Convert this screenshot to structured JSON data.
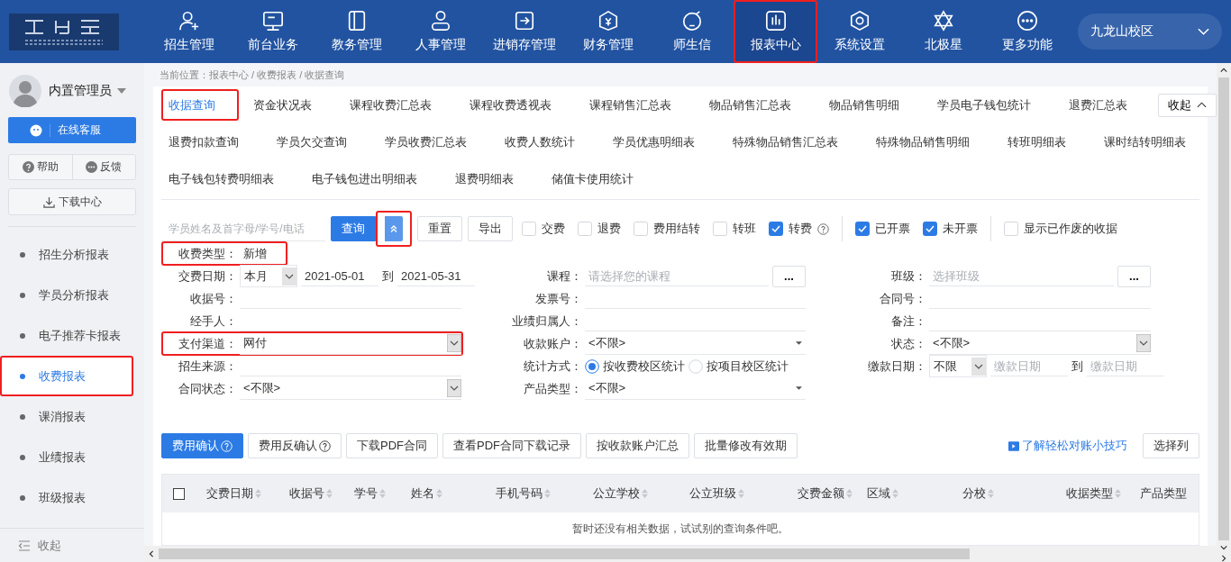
{
  "header": {
    "nav": [
      {
        "label": "招生管理",
        "selected": false,
        "highlighted": false
      },
      {
        "label": "前台业务",
        "selected": false,
        "highlighted": false
      },
      {
        "label": "教务管理",
        "selected": false,
        "highlighted": false
      },
      {
        "label": "人事管理",
        "selected": false,
        "highlighted": false
      },
      {
        "label": "进销存管理",
        "selected": false,
        "highlighted": false
      },
      {
        "label": "财务管理",
        "selected": false,
        "highlighted": false
      },
      {
        "label": "师生信",
        "selected": false,
        "highlighted": false
      },
      {
        "label": "报表中心",
        "selected": true,
        "highlighted": true
      },
      {
        "label": "系统设置",
        "selected": false,
        "highlighted": false
      },
      {
        "label": "北极星",
        "selected": false,
        "highlighted": false
      },
      {
        "label": "更多功能",
        "selected": false,
        "highlighted": false
      }
    ],
    "campus": "九龙山校区"
  },
  "sidebar": {
    "user": "内置管理员",
    "service_button": "在线客服",
    "help_button": "帮助",
    "feedback_button": "反馈",
    "download_button": "下载中心",
    "items": [
      {
        "label": "招生分析报表",
        "selected": false,
        "highlighted": false
      },
      {
        "label": "学员分析报表",
        "selected": false,
        "highlighted": false
      },
      {
        "label": "电子推荐卡报表",
        "selected": false,
        "highlighted": false
      },
      {
        "label": "收费报表",
        "selected": true,
        "highlighted": true
      },
      {
        "label": "课消报表",
        "selected": false,
        "highlighted": false
      },
      {
        "label": "业绩报表",
        "selected": false,
        "highlighted": false
      },
      {
        "label": "班级报表",
        "selected": false,
        "highlighted": false
      }
    ],
    "collapse": "收起"
  },
  "breadcrumb": "当前位置：报表中心 / 收费报表 / 收据查询",
  "report_tabs": [
    [
      {
        "label": "收据查询",
        "selected": true,
        "highlighted": true
      },
      {
        "label": "资金状况表",
        "selected": false,
        "highlighted": false
      },
      {
        "label": "课程收费汇总表",
        "selected": false,
        "highlighted": false
      },
      {
        "label": "课程收费透视表",
        "selected": false,
        "highlighted": false
      },
      {
        "label": "课程销售汇总表",
        "selected": false,
        "highlighted": false
      },
      {
        "label": "物品销售汇总表",
        "selected": false,
        "highlighted": false
      },
      {
        "label": "物品销售明细",
        "selected": false,
        "highlighted": false
      },
      {
        "label": "学员电子钱包统计",
        "selected": false,
        "highlighted": false
      },
      {
        "label": "退费汇总表",
        "selected": false,
        "highlighted": false
      }
    ],
    [
      {
        "label": "退费扣款查询",
        "selected": false,
        "highlighted": false
      },
      {
        "label": "学员欠交查询",
        "selected": false,
        "highlighted": false
      },
      {
        "label": "学员收费汇总表",
        "selected": false,
        "highlighted": false
      },
      {
        "label": "收费人数统计",
        "selected": false,
        "highlighted": false
      },
      {
        "label": "学员优惠明细表",
        "selected": false,
        "highlighted": false
      },
      {
        "label": "特殊物品销售汇总表",
        "selected": false,
        "highlighted": false
      },
      {
        "label": "特殊物品销售明细",
        "selected": false,
        "highlighted": false
      },
      {
        "label": "转班明细表",
        "selected": false,
        "highlighted": false
      },
      {
        "label": "课时结转明细表",
        "selected": false,
        "highlighted": false
      }
    ],
    [
      {
        "label": "电子钱包转费明细表",
        "selected": false,
        "highlighted": false
      },
      {
        "label": "电子钱包进出明细表",
        "selected": false,
        "highlighted": false
      },
      {
        "label": "退费明细表",
        "selected": false,
        "highlighted": false
      },
      {
        "label": "储值卡使用统计",
        "selected": false,
        "highlighted": false
      }
    ]
  ],
  "collapse_button": "收起",
  "search": {
    "placeholder": "学员姓名及首字母/学号/电话",
    "query_button": "查询",
    "toggle": {
      "highlighted": true
    },
    "reset_button": "重置",
    "export_button": "导出"
  },
  "check_groups": [
    [
      {
        "label": "交费",
        "checked": false,
        "help": false
      },
      {
        "label": "退费",
        "checked": false,
        "help": false
      },
      {
        "label": "费用结转",
        "checked": false,
        "help": false
      },
      {
        "label": "转班",
        "checked": false,
        "help": false
      },
      {
        "label": "转费",
        "checked": true,
        "help": true
      }
    ],
    [
      {
        "label": "已开票",
        "checked": true,
        "help": false
      },
      {
        "label": "未开票",
        "checked": true,
        "help": false
      }
    ],
    [
      {
        "label": "显示已作废的收据",
        "checked": false,
        "help": false
      }
    ]
  ],
  "charge_type": {
    "label": "收费类型：",
    "value": "新增",
    "highlighted": true
  },
  "form_rows": [
    [
      {
        "kind": "date_range",
        "label": "交费日期：",
        "period": "本月",
        "from": "2021-05-01",
        "to_text": "到",
        "to": "2021-05-31",
        "highlighted": false
      },
      {
        "kind": "lookup",
        "label": "课程：",
        "placeholder": "请选择您的课程",
        "button": "...",
        "highlighted": false
      },
      {
        "kind": "lookup",
        "label": "班级：",
        "placeholder": "选择班级",
        "button": "...",
        "highlighted": false
      }
    ],
    [
      {
        "kind": "text",
        "label": "收据号：",
        "highlighted": false
      },
      {
        "kind": "text",
        "label": "发票号：",
        "highlighted": false
      },
      {
        "kind": "text",
        "label": "合同号：",
        "highlighted": false
      }
    ],
    [
      {
        "kind": "text",
        "label": "经手人：",
        "highlighted": false
      },
      {
        "kind": "text",
        "label": "业绩归属人：",
        "highlighted": false
      },
      {
        "kind": "text",
        "label": "备注：",
        "highlighted": false
      }
    ],
    [
      {
        "kind": "select",
        "label": "支付渠道：",
        "value": "网付",
        "highlighted": true
      },
      {
        "kind": "dropdown",
        "label": "收款账户：",
        "value": "<不限>",
        "highlighted": false
      },
      {
        "kind": "select",
        "label": "状态：",
        "value": "<不限>",
        "highlighted": false
      }
    ],
    [
      {
        "kind": "text",
        "label": "招生来源：",
        "highlighted": false
      },
      {
        "kind": "radio",
        "label": "统计方式：",
        "options": [
          {
            "label": "按收费校区统计",
            "selected": true
          },
          {
            "label": "按项目校区统计",
            "selected": false
          }
        ],
        "highlighted": false
      },
      {
        "kind": "date_range",
        "label": "缴款日期：",
        "period": "不限",
        "from_placeholder": "缴款日期",
        "to_text": "到",
        "to_placeholder": "缴款日期",
        "highlighted": false
      }
    ],
    [
      {
        "kind": "select",
        "label": "合同状态：",
        "value": "<不限>",
        "highlighted": false
      },
      {
        "kind": "dropdown",
        "label": "产品类型：",
        "value": "<不限>",
        "highlighted": false
      }
    ]
  ],
  "actions": [
    {
      "label": "费用确认",
      "primary": true,
      "help": true
    },
    {
      "label": "费用反确认",
      "primary": false,
      "help": true
    },
    {
      "label": "下载PDF合同",
      "primary": false,
      "help": false
    },
    {
      "label": "查看PDF合同下载记录",
      "primary": false,
      "help": false
    },
    {
      "label": "按收款账户汇总",
      "primary": false,
      "help": false
    },
    {
      "label": "批量修改有效期",
      "primary": false,
      "help": false
    }
  ],
  "tips_link": "了解轻松对账小技巧",
  "columns_button": "选择列",
  "table": {
    "columns": [
      {
        "label": "交费日期",
        "sortable": true
      },
      {
        "label": "收据号",
        "sortable": true
      },
      {
        "label": "学号",
        "sortable": true
      },
      {
        "label": "姓名",
        "sortable": true
      },
      {
        "label": "手机号码",
        "sortable": true
      },
      {
        "label": "公立学校",
        "sortable": true
      },
      {
        "label": "公立班级",
        "sortable": true
      },
      {
        "label": "交费金额",
        "sortable": true
      },
      {
        "label": "区域",
        "sortable": true
      },
      {
        "label": "分校",
        "sortable": true
      },
      {
        "label": "收据类型",
        "sortable": true
      },
      {
        "label": "产品类型",
        "sortable": false
      }
    ],
    "empty_text": "暂时还没有相关数据，试试别的查询条件吧。"
  }
}
